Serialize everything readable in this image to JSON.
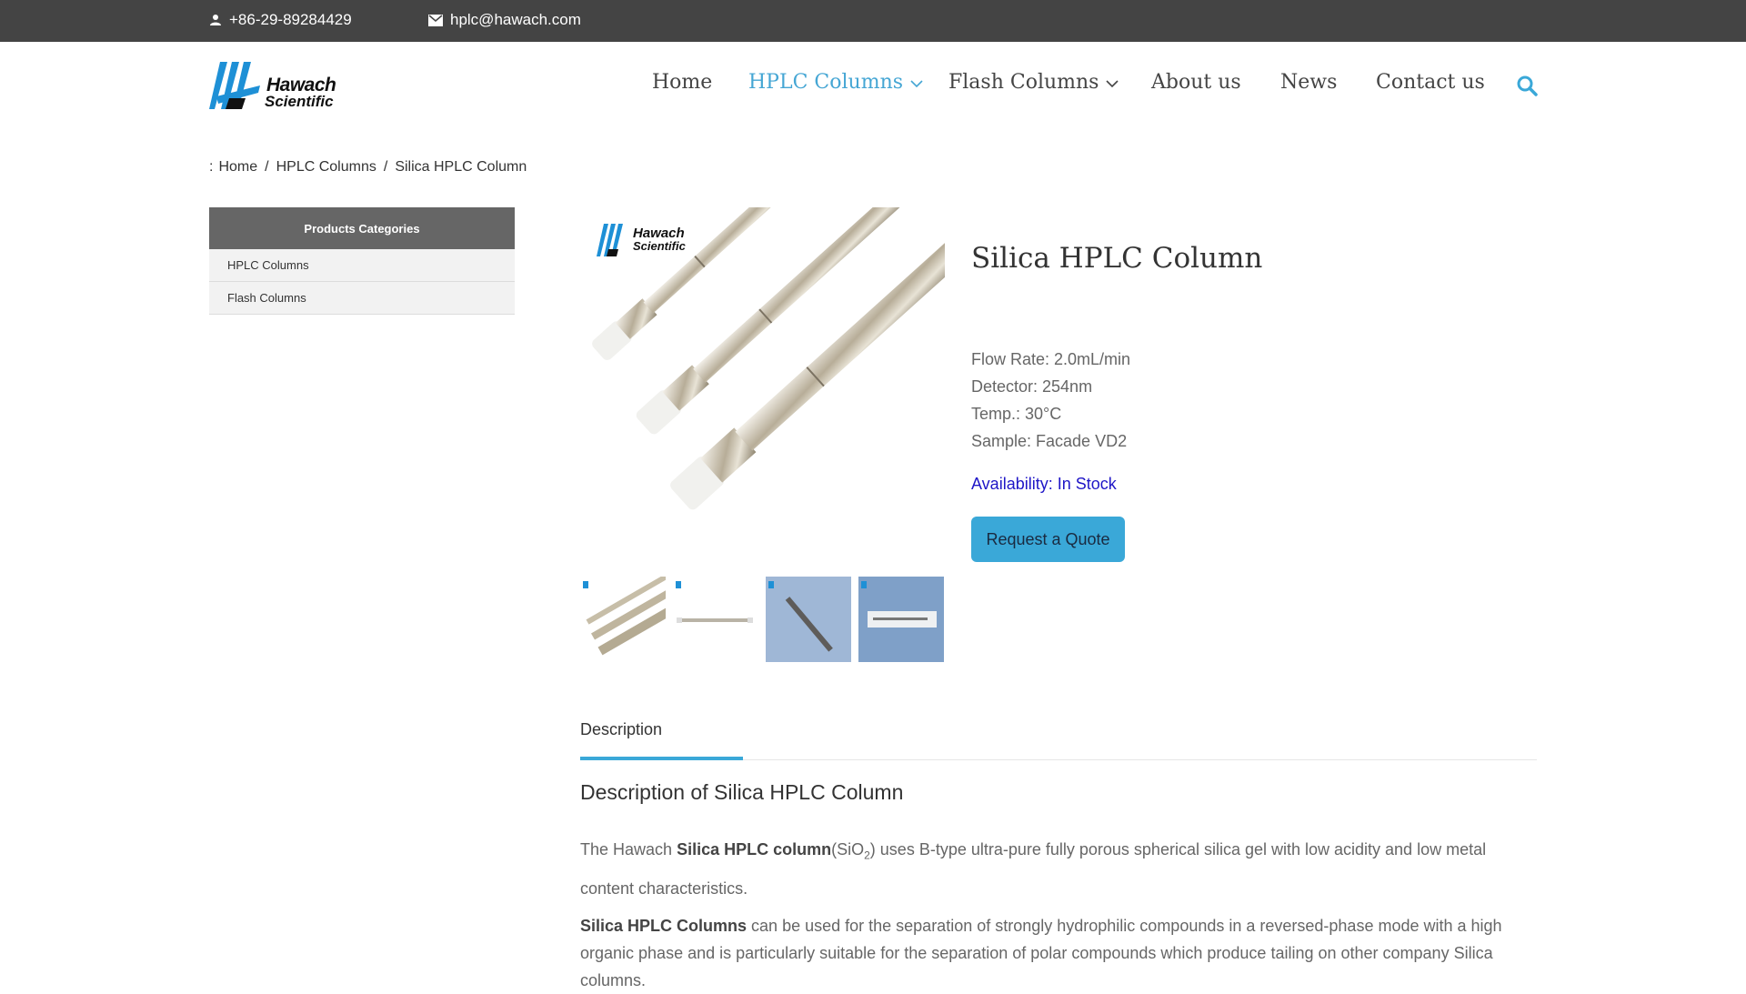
{
  "topbar": {
    "phone": "+86-29-89284429",
    "email": "hplc@hawach.com",
    "phone_icon": "person-icon",
    "email_icon": "envelope-icon"
  },
  "logo": {
    "line1": "Hawach",
    "line2": "Scientific",
    "color": "#1e90d6"
  },
  "nav": {
    "items": [
      {
        "label": "Home"
      },
      {
        "label": "HPLC Columns"
      },
      {
        "label": "Flash Columns"
      },
      {
        "label": "About us"
      },
      {
        "label": "News"
      },
      {
        "label": "Contact us"
      }
    ],
    "active_color": "#45a6d4",
    "search_icon": "search-icon"
  },
  "breadcrumb": {
    "prefix": ":",
    "items": [
      "Home",
      "HPLC Columns",
      "Silica HPLC Column"
    ],
    "separator": "/"
  },
  "sidebar": {
    "title": "Products Categories",
    "items": [
      {
        "label": "HPLC Columns"
      },
      {
        "label": "Flash Columns"
      }
    ]
  },
  "product": {
    "title": "Silica HPLC Column",
    "specs": [
      "Flow Rate: 2.0mL/min",
      "Detector: 254nm",
      "Temp.: 30°C",
      "Sample: Facade VD2"
    ],
    "availability": "Availability: In Stock",
    "quote_button": "Request a Quote",
    "image_logo_line1": "Hawach",
    "image_logo_line2": "Scientific"
  },
  "tabs": {
    "items": [
      {
        "label": "Description"
      }
    ]
  },
  "description": {
    "heading": "Description of Silica HPLC Column",
    "p1_lead": "The Hawach ",
    "p1_bold": "Silica HPLC column",
    "p1_formula_a": "(SiO",
    "p1_formula_sub": "2",
    "p1_rest": ") uses B-type ultra-pure fully porous spherical silica gel with low acidity and low metal content characteristics.",
    "p2_bold": "Silica HPLC Columns",
    "p2_rest": " can be used for the separation of strongly hydrophilic compounds in a reversed-phase mode with a high organic phase and is particularly suitable for the separation of polar compounds which produce tailing on other company Silica columns."
  }
}
